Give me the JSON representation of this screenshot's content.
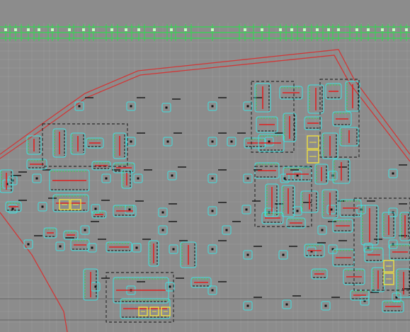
{
  "drawing": {
    "background": "#8c8c8c",
    "colors": {
      "grid": "#a0a0a0",
      "grid_dark": "#5a5a5a",
      "boundary": "#d03838",
      "green": "#30d850",
      "cyan": "#40e0e0",
      "red": "#e02020",
      "yellow": "#f0e040",
      "black": "#111111",
      "text": "#1a1a1a"
    }
  }
}
